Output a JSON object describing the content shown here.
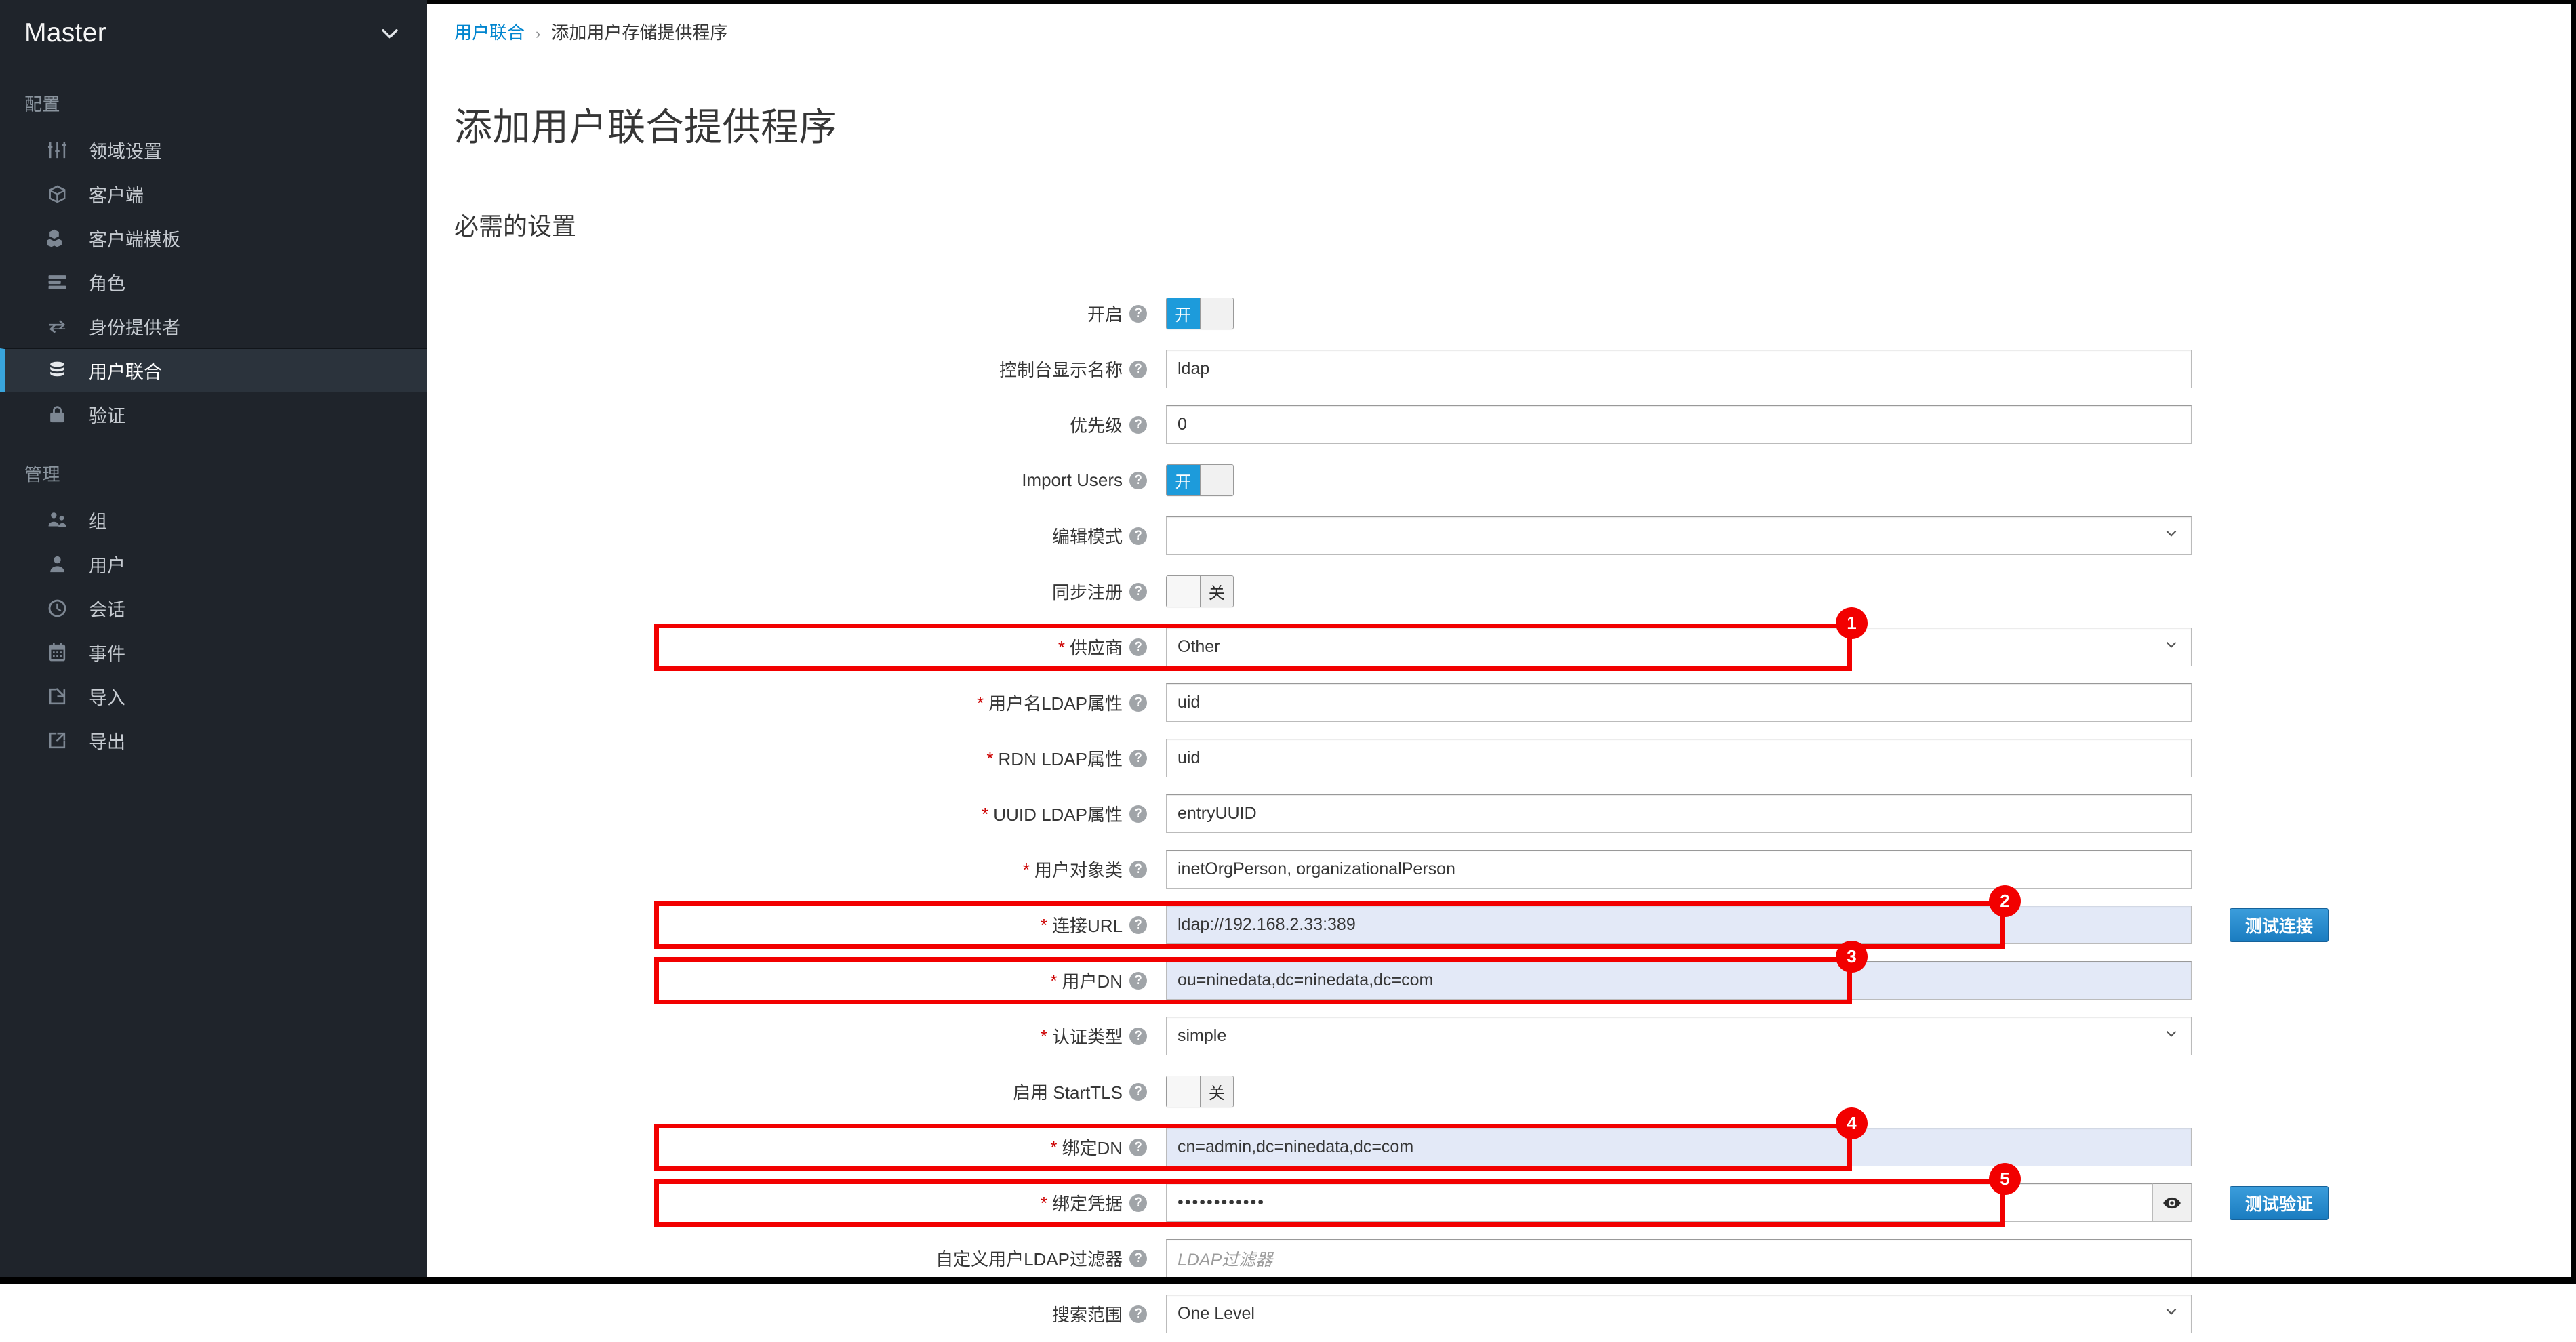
{
  "sidebar": {
    "realm": {
      "name": "Master",
      "caret_icon": "chevron-down-icon"
    },
    "sections": [
      {
        "title": "配置",
        "items": [
          {
            "label": "领域设置",
            "icon": "sliders-icon",
            "active": false
          },
          {
            "label": "客户端",
            "icon": "cube-icon",
            "active": false
          },
          {
            "label": "客户端模板",
            "icon": "cubes-icon",
            "active": false
          },
          {
            "label": "角色",
            "icon": "list-icon",
            "active": false
          },
          {
            "label": "身份提供者",
            "icon": "exchange-icon",
            "active": false
          },
          {
            "label": "用户联合",
            "icon": "database-icon",
            "active": true
          },
          {
            "label": "验证",
            "icon": "lock-icon",
            "active": false
          }
        ]
      },
      {
        "title": "管理",
        "items": [
          {
            "label": "组",
            "icon": "users-icon",
            "active": false
          },
          {
            "label": "用户",
            "icon": "user-icon",
            "active": false
          },
          {
            "label": "会话",
            "icon": "clock-icon",
            "active": false
          },
          {
            "label": "事件",
            "icon": "calendar-icon",
            "active": false
          },
          {
            "label": "导入",
            "icon": "import-icon",
            "active": false
          },
          {
            "label": "导出",
            "icon": "export-icon",
            "active": false
          }
        ]
      }
    ]
  },
  "breadcrumb": {
    "parent": "用户联合",
    "separator": "›",
    "current": "添加用户存储提供程序"
  },
  "page": {
    "title": "添加用户联合提供程序",
    "section_title": "必需的设置"
  },
  "form": {
    "help_icon": "question-circle-icon",
    "rows": [
      {
        "label": "开启",
        "required": false,
        "type": "toggle",
        "state": "on",
        "on_label": "开",
        "off_label": "关"
      },
      {
        "label": "控制台显示名称",
        "required": false,
        "type": "text",
        "value": "ldap",
        "placeholder": ""
      },
      {
        "label": "优先级",
        "required": false,
        "type": "text",
        "value": "0",
        "placeholder": ""
      },
      {
        "label": "Import Users",
        "required": false,
        "type": "toggle",
        "state": "on",
        "on_label": "开",
        "off_label": "关"
      },
      {
        "label": "编辑模式",
        "required": false,
        "type": "select",
        "value": "",
        "caret": "chevron-down-icon"
      },
      {
        "label": "同步注册",
        "required": false,
        "type": "toggle",
        "state": "off",
        "on_label": "开",
        "off_label": "关"
      },
      {
        "label": "供应商",
        "required": true,
        "type": "select",
        "value": "Other",
        "caret": "chevron-down-icon"
      },
      {
        "label": "用户名LDAP属性",
        "required": true,
        "type": "text",
        "value": "uid",
        "placeholder": ""
      },
      {
        "label": "RDN LDAP属性",
        "required": true,
        "type": "text",
        "value": "uid",
        "placeholder": ""
      },
      {
        "label": "UUID LDAP属性",
        "required": true,
        "type": "text",
        "value": "entryUUID",
        "placeholder": ""
      },
      {
        "label": "用户对象类",
        "required": true,
        "type": "text",
        "value": "inetOrgPerson, organizationalPerson",
        "placeholder": ""
      },
      {
        "label": "连接URL",
        "required": true,
        "type": "text",
        "value": "ldap://192.168.2.33:389",
        "placeholder": "",
        "autofill": true,
        "button": "测试连接"
      },
      {
        "label": "用户DN",
        "required": true,
        "type": "text",
        "value": "ou=ninedata,dc=ninedata,dc=com",
        "placeholder": "",
        "autofill": true
      },
      {
        "label": "认证类型",
        "required": true,
        "type": "select",
        "value": "simple",
        "caret": "chevron-down-icon"
      },
      {
        "label": "启用 StartTLS",
        "required": false,
        "type": "toggle",
        "state": "off",
        "on_label": "开",
        "off_label": "关"
      },
      {
        "label": "绑定DN",
        "required": true,
        "type": "text",
        "value": "cn=admin,dc=ninedata,dc=com",
        "placeholder": "",
        "autofill": true
      },
      {
        "label": "绑定凭据",
        "required": true,
        "type": "password",
        "value": "••••••••••••",
        "placeholder": "",
        "reveal_icon": "eye-icon",
        "button": "测试验证"
      },
      {
        "label": "自定义用户LDAP过滤器",
        "required": false,
        "type": "text",
        "value": "",
        "placeholder": "LDAP过滤器"
      },
      {
        "label": "搜索范围",
        "required": false,
        "type": "select",
        "value": "One Level",
        "caret": "chevron-down-icon"
      }
    ]
  },
  "annotations": [
    {
      "number": "1",
      "target_label": "供应商"
    },
    {
      "number": "2",
      "target_label": "连接URL"
    },
    {
      "number": "3",
      "target_label": "用户DN"
    },
    {
      "number": "4",
      "target_label": "绑定DN"
    },
    {
      "number": "5",
      "target_label": "绑定凭据"
    }
  ],
  "colors": {
    "sidebar_bg": "#1f242b",
    "sidebar_active_bg": "#2b333c",
    "accent_blue": "#0085cf",
    "toggle_on": "#1d9bdb",
    "annotation_red": "#f20000",
    "autofill_blue": "#e3e9f7",
    "button_blue": "#1a7cc0"
  }
}
